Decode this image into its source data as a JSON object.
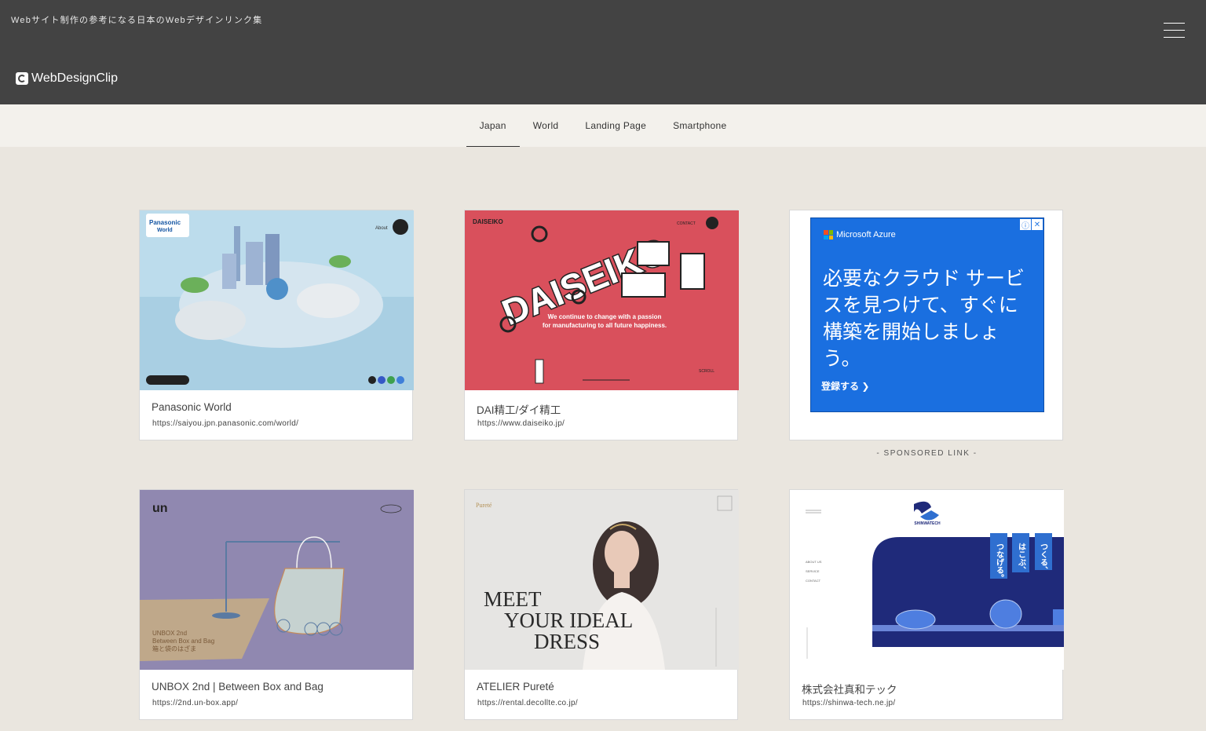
{
  "header": {
    "tagline": "Webサイト制作の参考になる日本のWebデザインリンク集",
    "logo_text": "WebDesignClip"
  },
  "nav": {
    "tabs": [
      {
        "label": "Japan"
      },
      {
        "label": "World"
      },
      {
        "label": "Landing Page"
      },
      {
        "label": "Smartphone"
      }
    ]
  },
  "cards": [
    {
      "title": "Panasonic World",
      "url": "https://saiyou.jpn.panasonic.com/world/",
      "thumb_text": [
        "Panasonic",
        "World",
        "About"
      ]
    },
    {
      "title": "DAI精工/ダイ精工",
      "url": "https://www.daiseiko.jp/",
      "thumb_text": [
        "DAISEIKO",
        "We continue to change with a passion",
        "for manufacturing to all future happiness.",
        "CONTACT",
        "SCROLL"
      ]
    },
    {
      "title": "UNBOX 2nd | Between Box and Bag",
      "url": "https://2nd.un-box.app/",
      "thumb_text": [
        "un",
        "UNBOX 2nd",
        "Between Box and Bag",
        "箱と袋のはざま"
      ]
    },
    {
      "title": "ATELIER Pureté",
      "url": "https://rental.decollte.co.jp/",
      "thumb_text": [
        "Pureté",
        "MEET",
        "YOUR IDEAL",
        "DRESS"
      ]
    },
    {
      "title": "株式会社真和テック",
      "url": "https://shinwa-tech.ne.jp/",
      "thumb_text": [
        "SHINWATECH",
        "つくる、",
        "はこぶ、",
        "つなげる。",
        "ABOUT US",
        "SERVICE",
        "CONTACT"
      ]
    }
  ],
  "ad": {
    "brand": "Microsoft Azure",
    "copy": "必要なクラウド サービスを見つけて、すぐに構築を開始しましょう。",
    "cta": "登録する ❯",
    "sponsored_label": "- SPONSORED LINK -"
  },
  "colors": {
    "header_bg": "#434343",
    "nav_bg": "#f3f1ec",
    "page_bg": "#eae6df",
    "ad_bg": "#1a6fe0",
    "daiseiko_red": "#d9505c",
    "unbox_purple": "#9088b0",
    "shinwa_navy": "#1f2a7a"
  }
}
